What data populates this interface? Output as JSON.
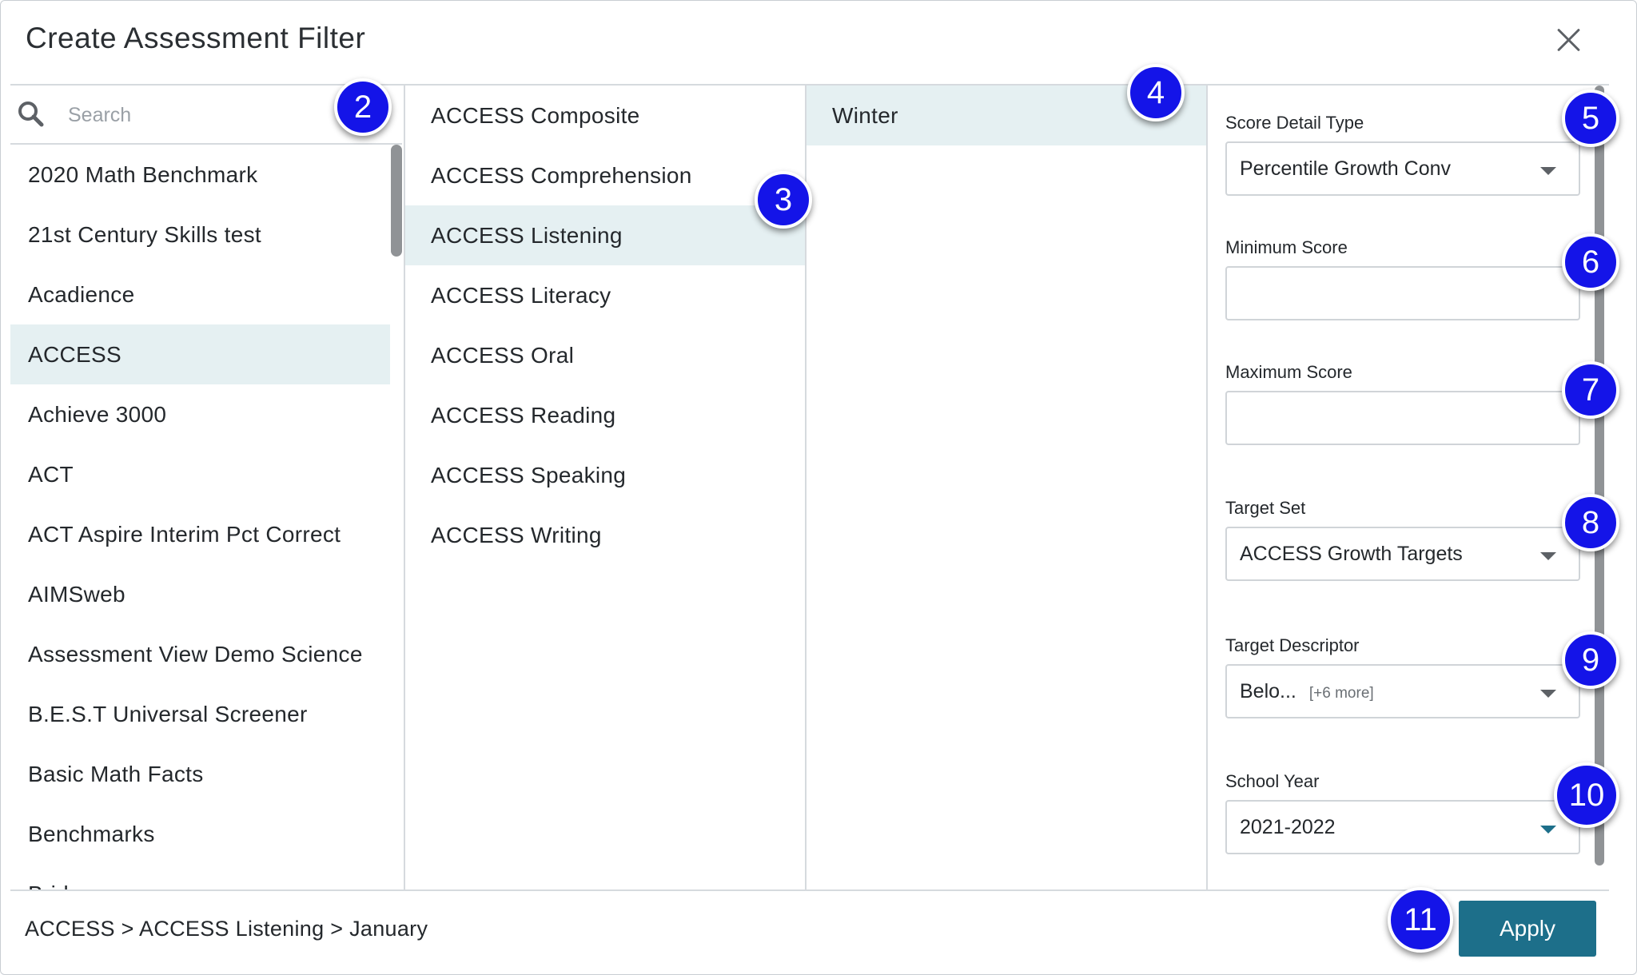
{
  "dialog": {
    "title": "Create Assessment Filter",
    "close_icon": "close-icon"
  },
  "search": {
    "placeholder": "Search",
    "value": ""
  },
  "assessments": [
    "2020 Math Benchmark",
    "21st Century Skills test",
    "Acadience",
    "ACCESS",
    "Achieve 3000",
    "ACT",
    "ACT Aspire Interim Pct Correct",
    "AIMSweb",
    "Assessment View Demo Science",
    "B.E.S.T Universal Screener",
    "Basic Math Facts",
    "Benchmarks",
    "Bridge"
  ],
  "selected_assessment": "ACCESS",
  "subtests": [
    "ACCESS Composite",
    "ACCESS Comprehension",
    "ACCESS Listening",
    "ACCESS Literacy",
    "ACCESS Oral",
    "ACCESS Reading",
    "ACCESS Speaking",
    "ACCESS Writing"
  ],
  "selected_subtest": "ACCESS Listening",
  "windows": [
    "Winter"
  ],
  "selected_window": "Winter",
  "fields": {
    "score_detail_type": {
      "label": "Score Detail Type",
      "value": "Percentile Growth Conv"
    },
    "minimum_score": {
      "label": "Minimum Score",
      "value": ""
    },
    "maximum_score": {
      "label": "Maximum Score",
      "value": ""
    },
    "target_set": {
      "label": "Target Set",
      "value": "ACCESS Growth Targets"
    },
    "target_descriptor": {
      "label": "Target Descriptor",
      "value": "Belo...",
      "more": "[+6 more]"
    },
    "school_year": {
      "label": "School Year",
      "value": "2021-2022"
    }
  },
  "footer": {
    "breadcrumb": "ACCESS > ACCESS Listening > January",
    "apply_label": "Apply"
  },
  "badges": [
    "2",
    "3",
    "4",
    "5",
    "6",
    "7",
    "8",
    "9",
    "10",
    "11"
  ],
  "colors": {
    "accent": "#1d6f8a",
    "selected_row": "#e5f0f2",
    "badge": "#1414e8"
  }
}
